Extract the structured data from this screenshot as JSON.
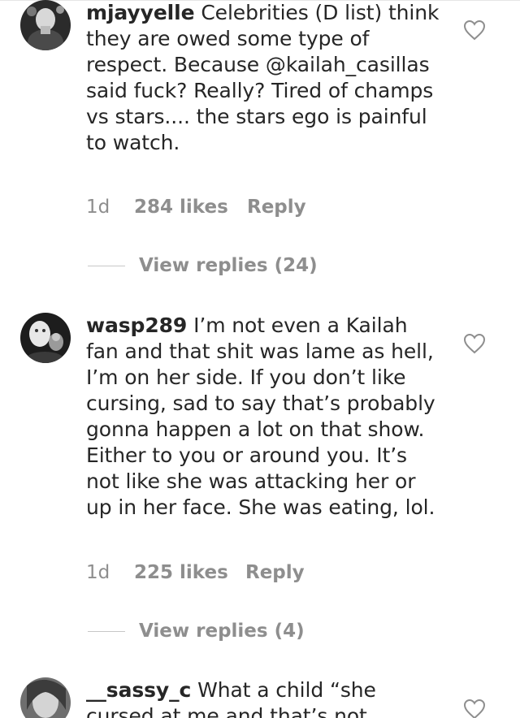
{
  "comments": [
    {
      "username": "mjayyelle",
      "text": " Celebrities (D list) think they are owed some type of respect. Because @kailah_casillas said fuck? Really? Tired of champs vs stars.... the stars ego is painful to watch.",
      "time": "1d",
      "likes": "284 likes",
      "reply_label": "Reply",
      "view_replies": "View replies (24)"
    },
    {
      "username": "wasp289",
      "text": " I’m not even a Kailah fan and that shit was lame as hell, I’m on her side. If you don’t like cursing, sad to say that’s probably gonna happen a lot on that show. Either to you or around you. It’s not like she was attacking her or up in her face. She was eating, lol.",
      "time": "1d",
      "likes": "225 likes",
      "reply_label": "Reply",
      "view_replies": "View replies (4)"
    },
    {
      "username": "__sassy_c",
      "text": " What a child “she cursed at me and that’s not"
    }
  ]
}
